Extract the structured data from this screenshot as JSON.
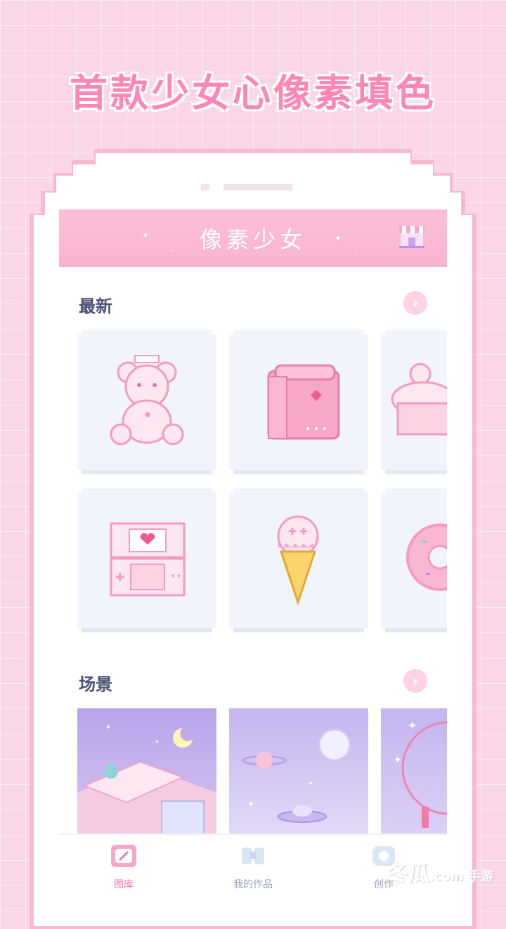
{
  "promo": {
    "title": "首款少女心像素填色"
  },
  "app": {
    "title": "像素少女"
  },
  "sections": {
    "latest": {
      "title": "最新",
      "more_label": "›"
    },
    "scenes": {
      "title": "场景",
      "more_label": "›"
    }
  },
  "latest_items": [
    "teddy-bear",
    "school-backpack",
    "cupcake",
    "handheld-console",
    "ice-cream-cone",
    "donut"
  ],
  "scene_items": [
    "bedroom-night",
    "space-planets",
    "pink-moon"
  ],
  "tabbar": {
    "gallery_label": "图库",
    "works_label": "我的作品",
    "create_label": "创作"
  },
  "watermark": {
    "text": "冬瓜",
    "suffix": ".com 手游"
  },
  "colors": {
    "accent": "#ff86b6",
    "header": "#f9b3cf",
    "text": "#4b5175"
  }
}
